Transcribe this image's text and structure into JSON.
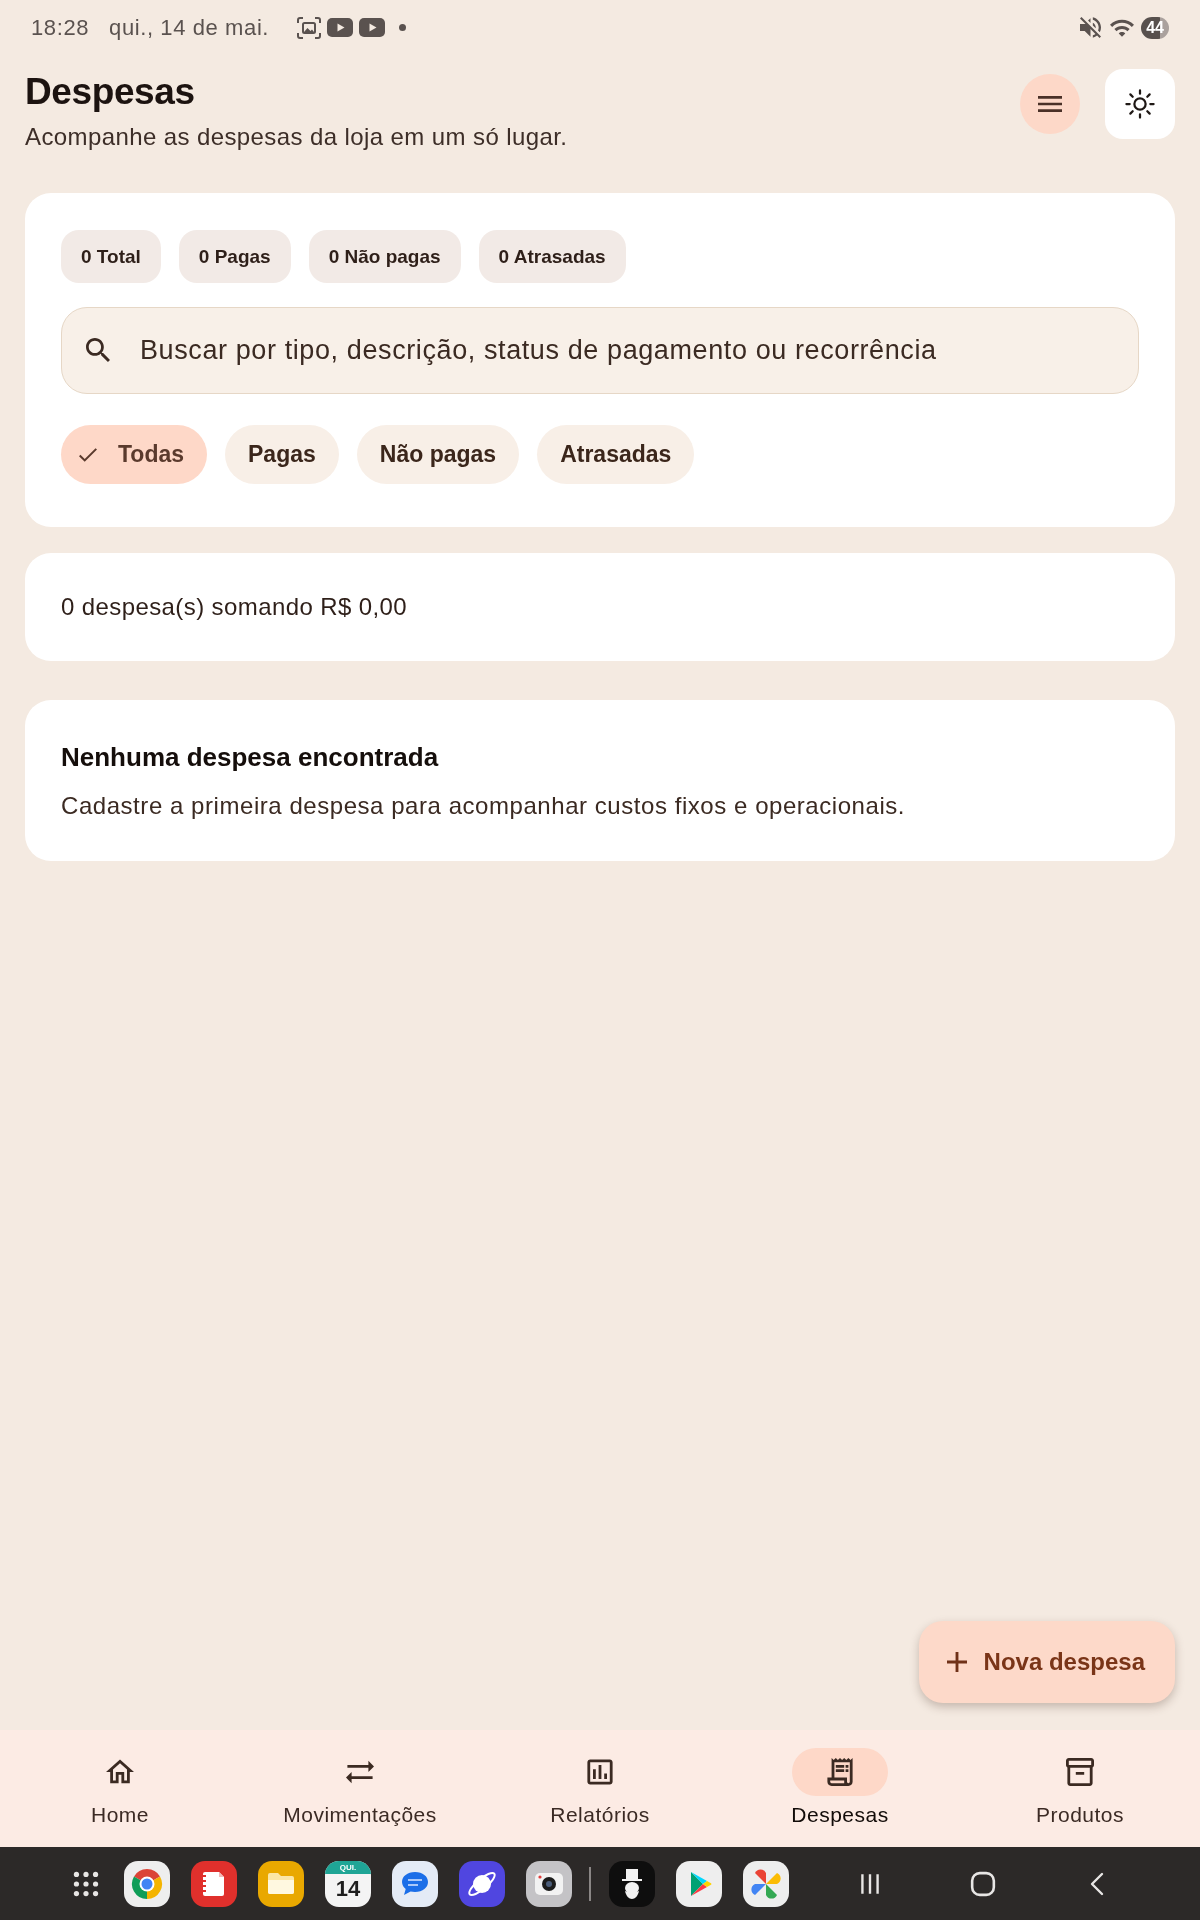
{
  "status_bar": {
    "time": "18:28",
    "date": "qui., 14 de mai.",
    "battery": "44"
  },
  "header": {
    "title": "Despesas",
    "subtitle": "Acompanhe as despesas da loja em um só lugar."
  },
  "summary_chips": [
    "0 Total",
    "0 Pagas",
    "0 Não pagas",
    "0 Atrasadas"
  ],
  "search": {
    "placeholder": "Buscar por tipo, descrição, status de pagamento ou recorrência"
  },
  "filters": [
    {
      "label": "Todas",
      "selected": true
    },
    {
      "label": "Pagas",
      "selected": false
    },
    {
      "label": "Não pagas",
      "selected": false
    },
    {
      "label": "Atrasadas",
      "selected": false
    }
  ],
  "summary": {
    "text": "0 despesa(s) somando R$ 0,00"
  },
  "empty_state": {
    "title": "Nenhuma despesa encontrada",
    "message": "Cadastre a primeira despesa para acompanhar custos fixos e operacionais."
  },
  "fab": {
    "label": "Nova despesa"
  },
  "bottom_nav": [
    {
      "label": "Home",
      "selected": false
    },
    {
      "label": "Movimentações",
      "selected": false
    },
    {
      "label": "Relatórios",
      "selected": false
    },
    {
      "label": "Despesas",
      "selected": true
    },
    {
      "label": "Produtos",
      "selected": false
    }
  ],
  "taskbar": {
    "calendar_weekday": "QUI.",
    "calendar_day": "14"
  }
}
